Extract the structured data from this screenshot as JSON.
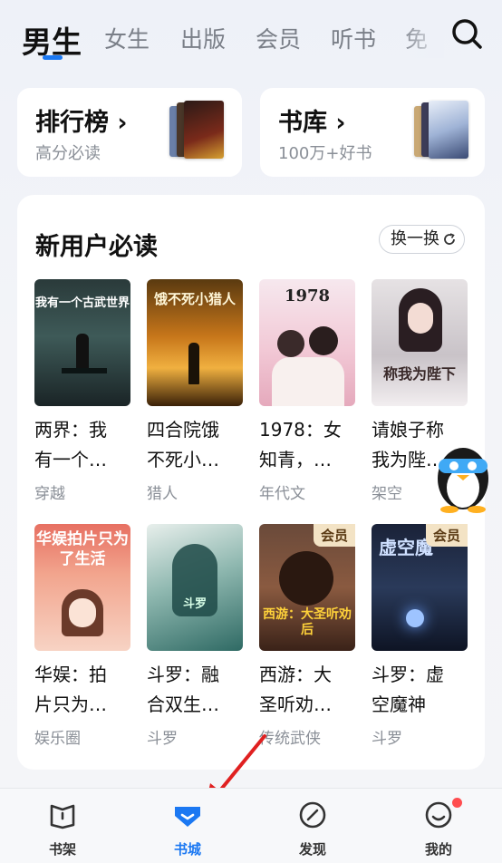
{
  "tabs": [
    {
      "label": "男生"
    },
    {
      "label": "女生"
    },
    {
      "label": "出版"
    },
    {
      "label": "会员"
    },
    {
      "label": "听书"
    },
    {
      "label": "免"
    }
  ],
  "top_cards": {
    "ranking": {
      "title": "排行榜",
      "subtitle": "高分必读"
    },
    "library": {
      "title": "书库",
      "subtitle": "100万+好书"
    }
  },
  "section": {
    "title": "新用户必读",
    "refresh_label": "换一换"
  },
  "books": [
    {
      "title_line1": "两界：我",
      "title_line2": "有一个…",
      "genre": "穿越",
      "cover_text": "我有一个古武世界",
      "vip": ""
    },
    {
      "title_line1": "四合院饿",
      "title_line2": "不死小…",
      "genre": "猎人",
      "cover_text": "饿不死小猎人",
      "vip": ""
    },
    {
      "title_line1": "1978：女",
      "title_line2": "知青，…",
      "genre": "年代文",
      "cover_text": "1978",
      "vip": ""
    },
    {
      "title_line1": "请娘子称",
      "title_line2": "我为陛…",
      "genre": "架空",
      "cover_text": "称我为陛下",
      "vip": ""
    },
    {
      "title_line1": "华娱：拍",
      "title_line2": "片只为…",
      "genre": "娱乐圈",
      "cover_text": "华娱拍片只为了生活",
      "vip": ""
    },
    {
      "title_line1": "斗罗：融",
      "title_line2": "合双生…",
      "genre": "斗罗",
      "cover_text": "斗罗",
      "vip": ""
    },
    {
      "title_line1": "西游：大",
      "title_line2": "圣听劝…",
      "genre": "传统武侠",
      "cover_text": "西游：大圣听劝后",
      "vip": "会员"
    },
    {
      "title_line1": "斗罗：虚",
      "title_line2": "空魔神",
      "genre": "斗罗",
      "cover_text": "虚空魔",
      "vip": "会员"
    }
  ],
  "bottom_nav": [
    {
      "label": "书架",
      "icon": "bookshelf-icon"
    },
    {
      "label": "书城",
      "icon": "bookstore-icon"
    },
    {
      "label": "发现",
      "icon": "discover-icon"
    },
    {
      "label": "我的",
      "icon": "profile-icon"
    }
  ],
  "colors": {
    "accent": "#1b78f2",
    "badge": "#ff4d4f",
    "vip_bg": "#f3e3c5"
  }
}
